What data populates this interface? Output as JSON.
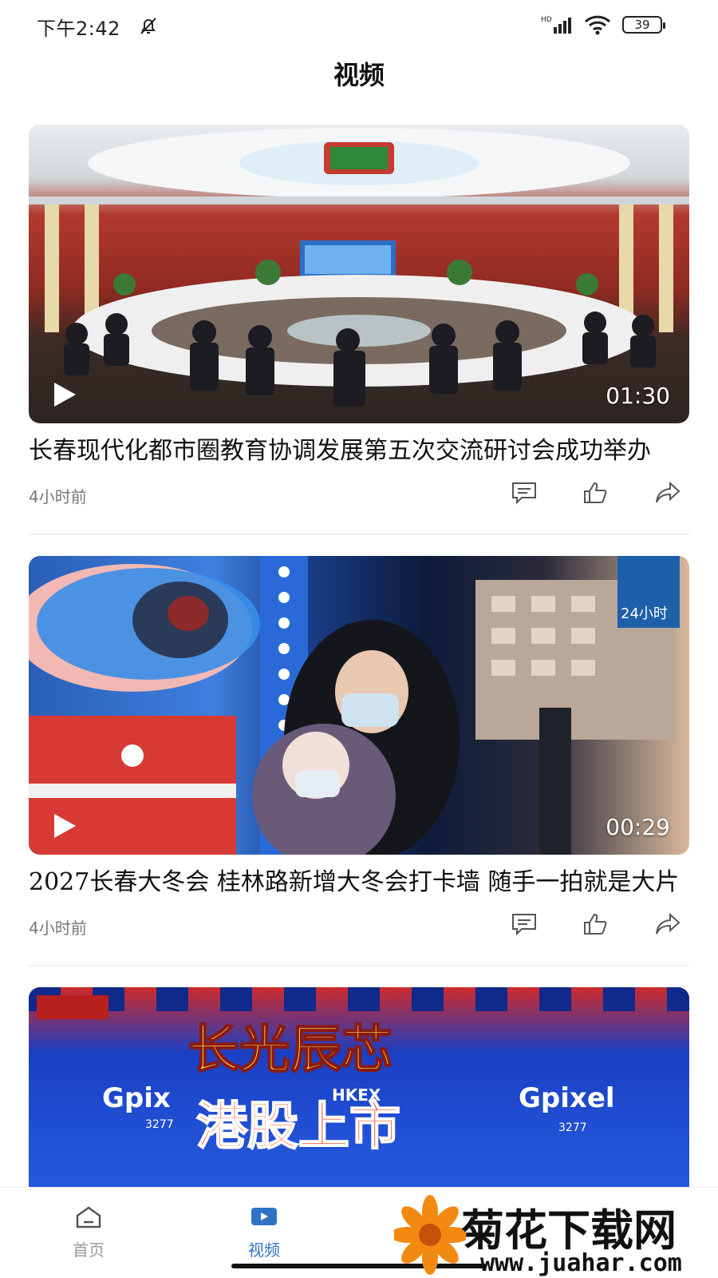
{
  "status_bar": {
    "time": "下午2:42",
    "battery": "39"
  },
  "header": {
    "title": "视频"
  },
  "videos": [
    {
      "title": "长春现代化都市圈教育协调发展第五次交流研讨会成功举办",
      "duration": "01:30",
      "time_ago": "4小时前"
    },
    {
      "title": "2027长春大冬会 桂林路新增大冬会打卡墙 随手一拍就是大片",
      "duration": "00:29",
      "time_ago": "4小时前"
    },
    {
      "title": "",
      "duration": "",
      "time_ago": ""
    }
  ],
  "scene_text": {
    "banner_main": "长光辰芯",
    "banner_sub": "港股上市",
    "brand_left": "Gpix",
    "brand_right": "Gpixel",
    "hkex": "HKEX",
    "code_left": "3277",
    "code_right": "3277",
    "sign_24h": "24小时"
  },
  "bottom_nav": [
    {
      "label": "首页",
      "icon": "home-icon",
      "active": false
    },
    {
      "label": "视频",
      "icon": "video-icon",
      "active": true
    }
  ],
  "watermark": {
    "name": "菊花下载网",
    "url": "www.juahar.com"
  },
  "colors": {
    "accent": "#2f73c7",
    "meta_text": "#777777"
  }
}
